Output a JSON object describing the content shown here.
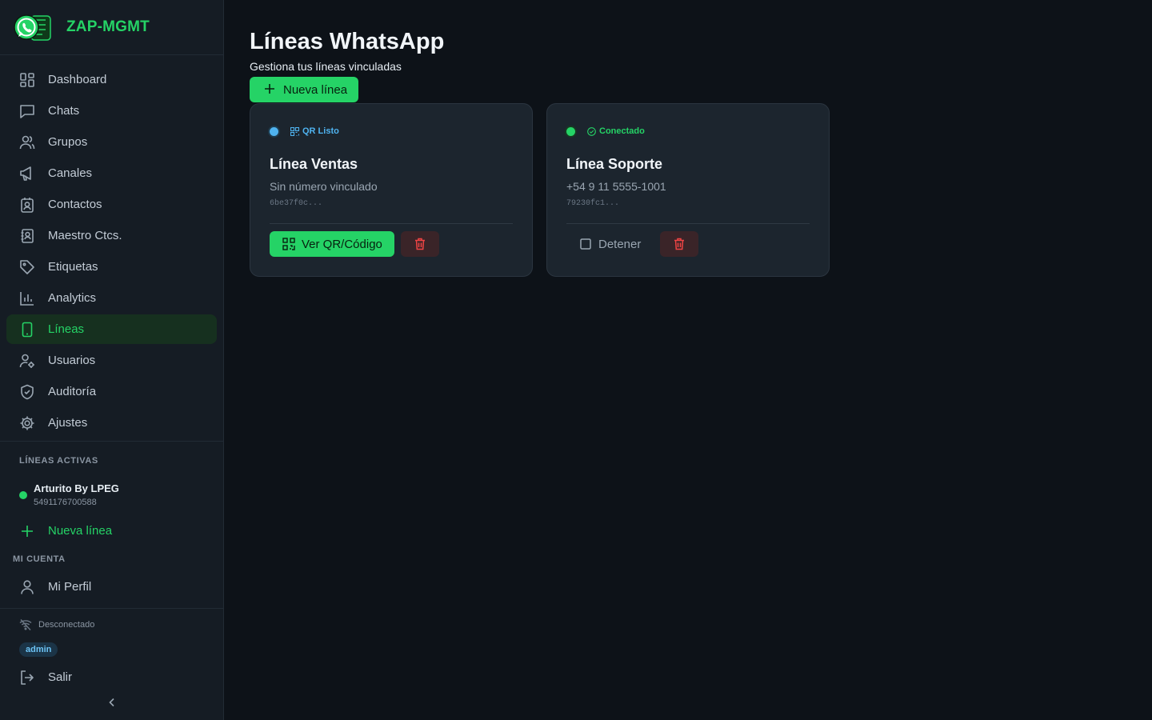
{
  "app": {
    "title": "ZAP-MGMT"
  },
  "colors": {
    "accent": "#25d366",
    "sidebar_bg": "#151c24",
    "page_bg": "#0d1218",
    "danger": "#ef4444",
    "info": "#4fb3f0"
  },
  "sidebar": {
    "items": [
      {
        "label": "Dashboard",
        "icon": "dashboard-icon"
      },
      {
        "label": "Chats",
        "icon": "chat-icon"
      },
      {
        "label": "Grupos",
        "icon": "users-icon"
      },
      {
        "label": "Canales",
        "icon": "megaphone-icon"
      },
      {
        "label": "Contactos",
        "icon": "contact-icon"
      },
      {
        "label": "Maestro Ctcs.",
        "icon": "contact-book-icon"
      },
      {
        "label": "Etiquetas",
        "icon": "tag-icon"
      },
      {
        "label": "Analytics",
        "icon": "bar-chart-icon"
      },
      {
        "label": "Líneas",
        "icon": "phone-icon",
        "active": true
      },
      {
        "label": "Usuarios",
        "icon": "user-gear-icon"
      },
      {
        "label": "Auditoría",
        "icon": "shield-icon"
      },
      {
        "label": "Ajustes",
        "icon": "gear-icon"
      }
    ],
    "active_lines": {
      "label": "LÍNEAS ACTIVAS",
      "lines": [
        {
          "name": "Arturito By LPEG",
          "number": "5491176700588"
        }
      ],
      "new_line_label": "Nueva línea"
    },
    "account": {
      "label": "MI CUENTA",
      "profile_label": "Mi Perfil"
    },
    "footer": {
      "connection_status": "Desconectado",
      "role": "admin",
      "logout_label": "Salir"
    }
  },
  "main": {
    "title": "Líneas WhatsApp",
    "subtitle": "Gestiona tus líneas vinculadas",
    "new_line_button": "Nueva línea",
    "cards": [
      {
        "status": "QR Listo",
        "status_color": "#4fb3f0",
        "name": "Línea Ventas",
        "phone": "Sin número vinculado",
        "id": "6be37f0c...",
        "primary_action": "Ver QR/Código"
      },
      {
        "status": "Conectado",
        "status_color": "#25d366",
        "name": "Línea Soporte",
        "phone": "+54 9 11 5555-1001",
        "id": "79230fc1...",
        "primary_action": "Detener"
      }
    ]
  }
}
